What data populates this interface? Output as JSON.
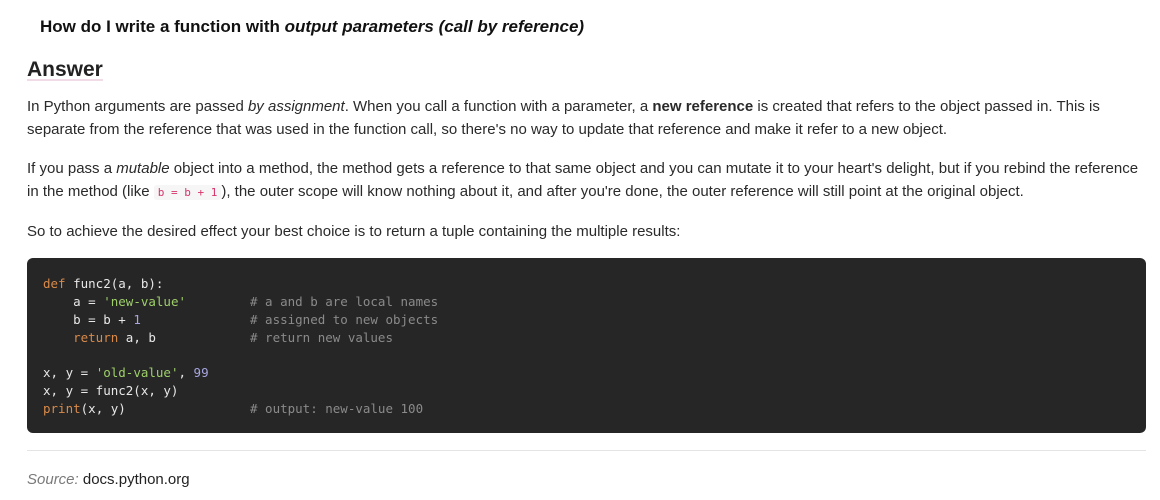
{
  "question": {
    "prefix": "How do I write a function with ",
    "emphasis": "output parameters (call by reference)"
  },
  "answer": {
    "heading": "Answer",
    "p1": {
      "t1": "In Python arguments are passed ",
      "em1": "by assignment",
      "t2": ". When you call a function with a parameter, a ",
      "strong1": "new reference",
      "t3": " is created that refers to the object passed in. This is separate from the reference that was used in the function call, so there's no way to update that reference and make it refer to a new object."
    },
    "p2": {
      "t1": "If you pass a ",
      "em1": "mutable",
      "t2": " object into a method, the method gets a reference to that same object and you can mutate it to your heart's delight, but if you rebind the reference in the method (like ",
      "code1": "b = b + 1",
      "t3": "), the outer scope will know nothing about it, and after you're done, the outer reference will still point at the original object."
    },
    "p3": "So to achieve the desired effect your best choice is to return a tuple containing the multiple results:"
  },
  "code": {
    "line1": {
      "kw": "def",
      "rest": " func2(a, b):"
    },
    "line2": {
      "pre": "    a = ",
      "str": "'new-value'",
      "comment": "# a and b are local names"
    },
    "line3": {
      "pre": "    b = b + ",
      "num": "1",
      "comment": "# assigned to new objects"
    },
    "line4": {
      "indent": "    ",
      "kw": "return",
      "rest": " a, b",
      "comment": "# return new values"
    },
    "line5": {
      "pre": "x, y = ",
      "str": "'old-value'",
      "mid": ", ",
      "num": "99"
    },
    "line6": {
      "text": "x, y = func2(x, y)"
    },
    "line7": {
      "kw": "print",
      "rest": "(x, y)",
      "comment": "# output: new-value 100"
    }
  },
  "source": {
    "label": "Source:",
    "value": " docs.python.org"
  }
}
